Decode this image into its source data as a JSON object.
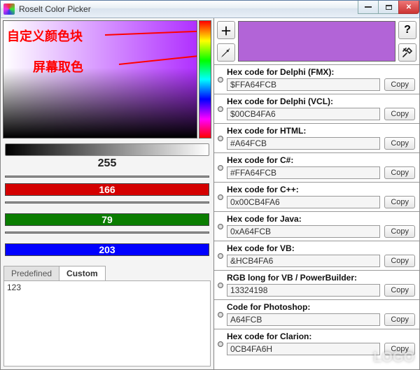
{
  "window": {
    "title": "Roselt Color Picker"
  },
  "annotations": {
    "custom_block": "自定义颜色块",
    "screen_pick": "屏幕取色"
  },
  "sliders": {
    "alpha": "255",
    "r": "166",
    "g": "79",
    "b": "203"
  },
  "tabs": {
    "predefined": "Predefined",
    "custom": "Custom",
    "custom_body": "123"
  },
  "tool_buttons": {
    "add": "＋",
    "eyedrop": "eyedropper",
    "help": "?",
    "settings": "⚙"
  },
  "copy_label": "Copy",
  "hex_rows": [
    {
      "label": "Hex code for Delphi (FMX):",
      "value": "$FFA64FCB"
    },
    {
      "label": "Hex code for Delphi (VCL):",
      "value": "$00CB4FA6"
    },
    {
      "label": "Hex code for HTML:",
      "value": "#A64FCB"
    },
    {
      "label": "Hex code for C#:",
      "value": "#FFA64FCB"
    },
    {
      "label": "Hex code for C++:",
      "value": "0x00CB4FA6"
    },
    {
      "label": "Hex code for Java:",
      "value": "0xA64FCB"
    },
    {
      "label": "Hex code for VB:",
      "value": "&HCB4FA6"
    },
    {
      "label": "RGB long for VB / PowerBuilder:",
      "value": "13324198"
    },
    {
      "label": "Code for Photoshop:",
      "value": "A64FCB"
    },
    {
      "label": "Hex code for Clarion:",
      "value": "0CB4FA6H"
    }
  ],
  "swatch_color": "#b264d7"
}
